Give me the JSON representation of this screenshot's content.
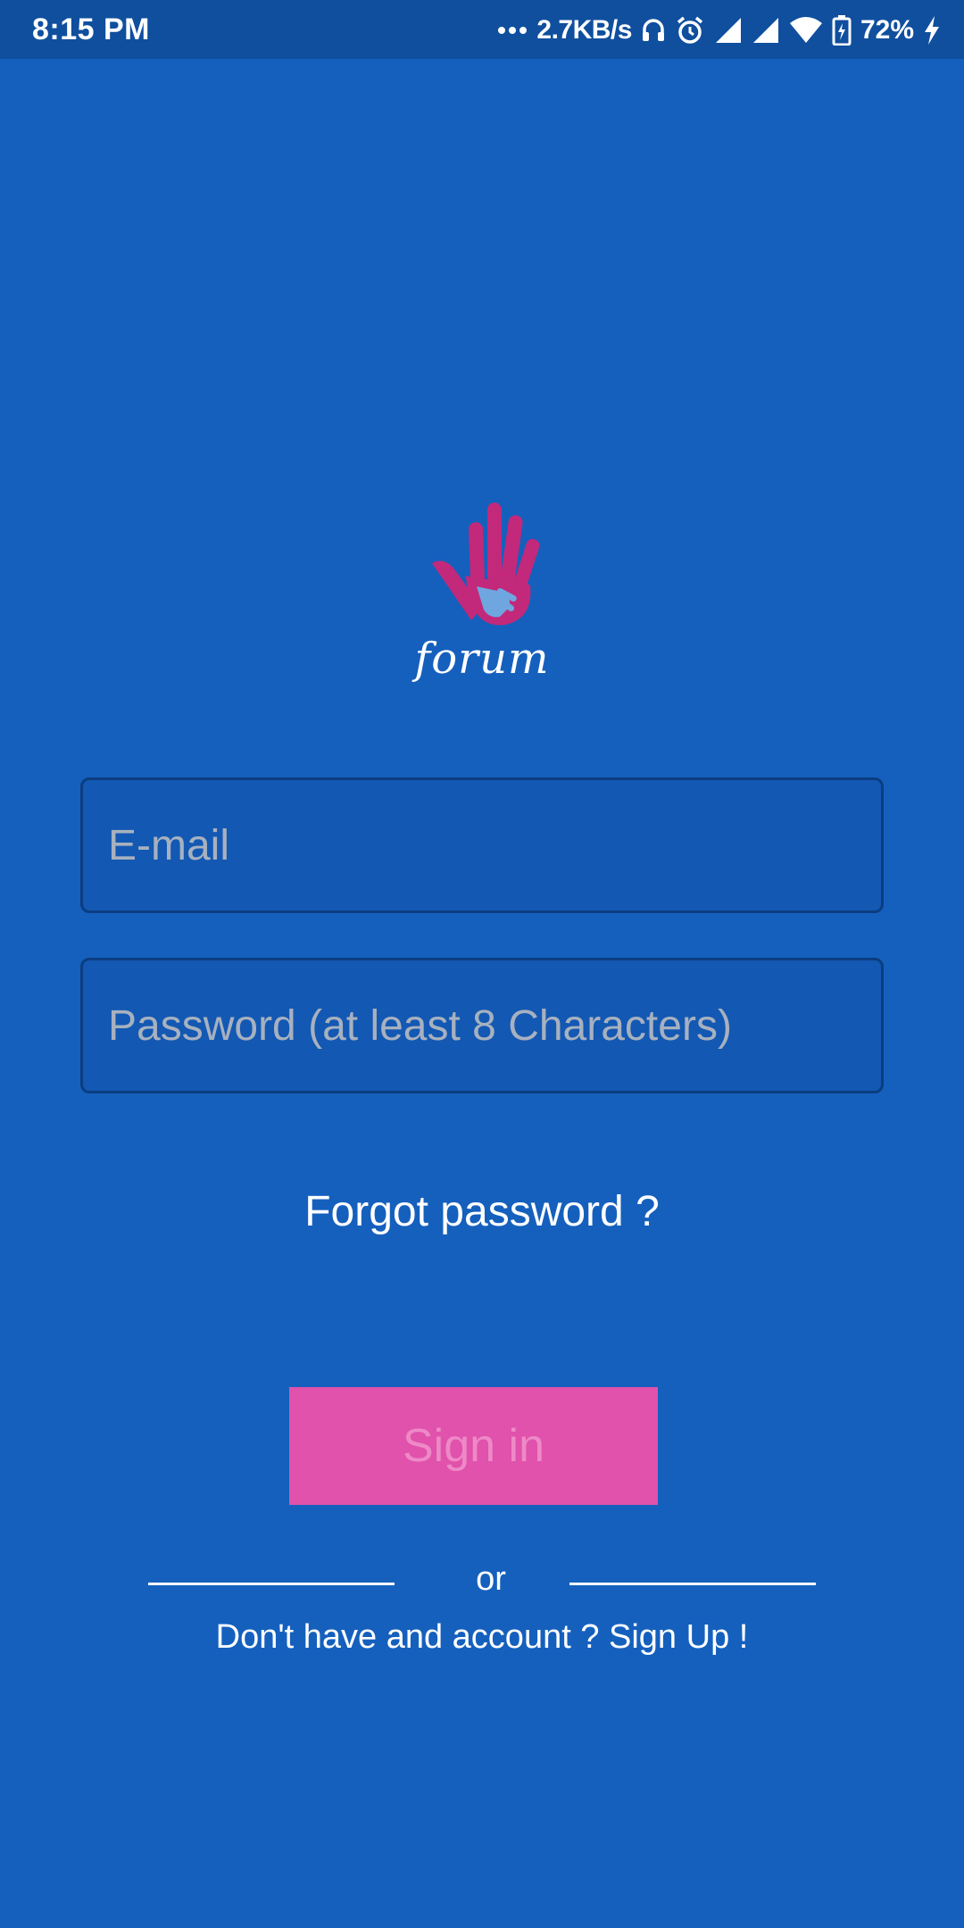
{
  "status_bar": {
    "time": "8:15 PM",
    "network_speed": "2.7KB/s",
    "battery": "72%",
    "icons": [
      "more-dots-icon",
      "headset-icon",
      "alarm-icon",
      "signal-icon",
      "signal-icon",
      "wifi-icon",
      "battery-icon",
      "charging-icon"
    ]
  },
  "logo": {
    "text": "forum",
    "icon": "hand-logo-icon",
    "color": "#C2297A"
  },
  "form": {
    "email_placeholder": "E-mail",
    "password_placeholder": "Password (at least 8 Characters)",
    "forgot_password": "Forgot password ?",
    "sign_in_label": "Sign in",
    "or_label": "or",
    "sign_up_text": "Don't have and account ? Sign Up !"
  },
  "colors": {
    "background": "#1560BD",
    "status_bar": "#0F4F9E",
    "button": "#E052AB",
    "button_text": "#EE89C7"
  }
}
